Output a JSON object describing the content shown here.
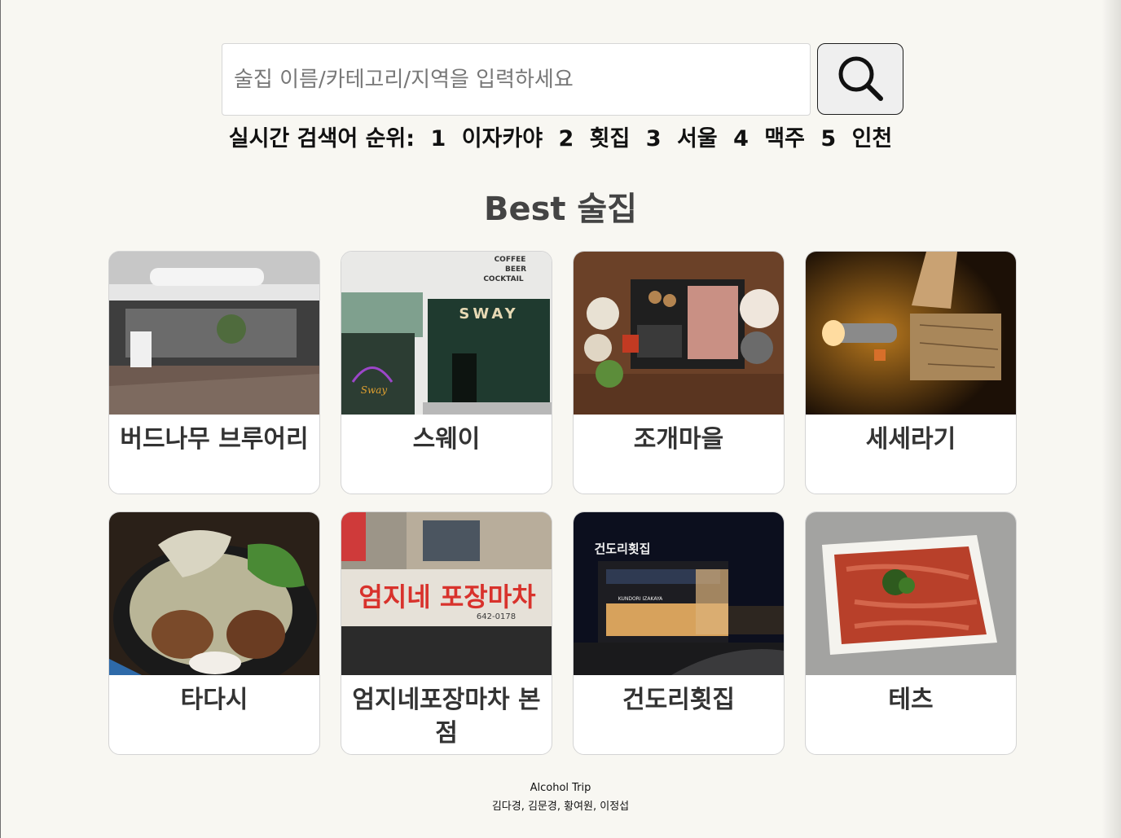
{
  "search": {
    "placeholder": "술집 이름/카테고리/지역을 입력하세요",
    "value": "",
    "button_icon": "search-icon"
  },
  "trending": {
    "label": "실시간 검색어 순위:",
    "items": [
      {
        "rank": "1",
        "term": "이자카야"
      },
      {
        "rank": "2",
        "term": "횟집"
      },
      {
        "rank": "3",
        "term": "서울"
      },
      {
        "rank": "4",
        "term": "맥주"
      },
      {
        "rank": "5",
        "term": "인천"
      }
    ]
  },
  "best": {
    "title": "Best 술집",
    "cards": [
      {
        "name": "버드나무 브루어리"
      },
      {
        "name": "스웨이"
      },
      {
        "name": "조개마을"
      },
      {
        "name": "세세라기"
      },
      {
        "name": "타다시"
      },
      {
        "name": "엄지네포장마차 본점"
      },
      {
        "name": "건도리횟집"
      },
      {
        "name": "테츠"
      }
    ]
  },
  "photo_text": {
    "sway_sign": "SWAY",
    "sway_tagline": [
      "COFFEE",
      "BEER",
      "COCKTAIL"
    ],
    "sway_logo": "Sway",
    "pocha_sign": "엄지네 포장마차",
    "pocha_phone": "642-0178",
    "kundori_sign": "건도리횟집",
    "kundori_sub": "KUNDORI IZAKAYA"
  },
  "footer": {
    "title": "Alcohol Trip",
    "authors": "김다경, 김문경, 황여원, 이정섭"
  },
  "colors": {
    "background": "#f8f7f2",
    "card_border": "#d4d4d4",
    "title_text": "#444444"
  }
}
